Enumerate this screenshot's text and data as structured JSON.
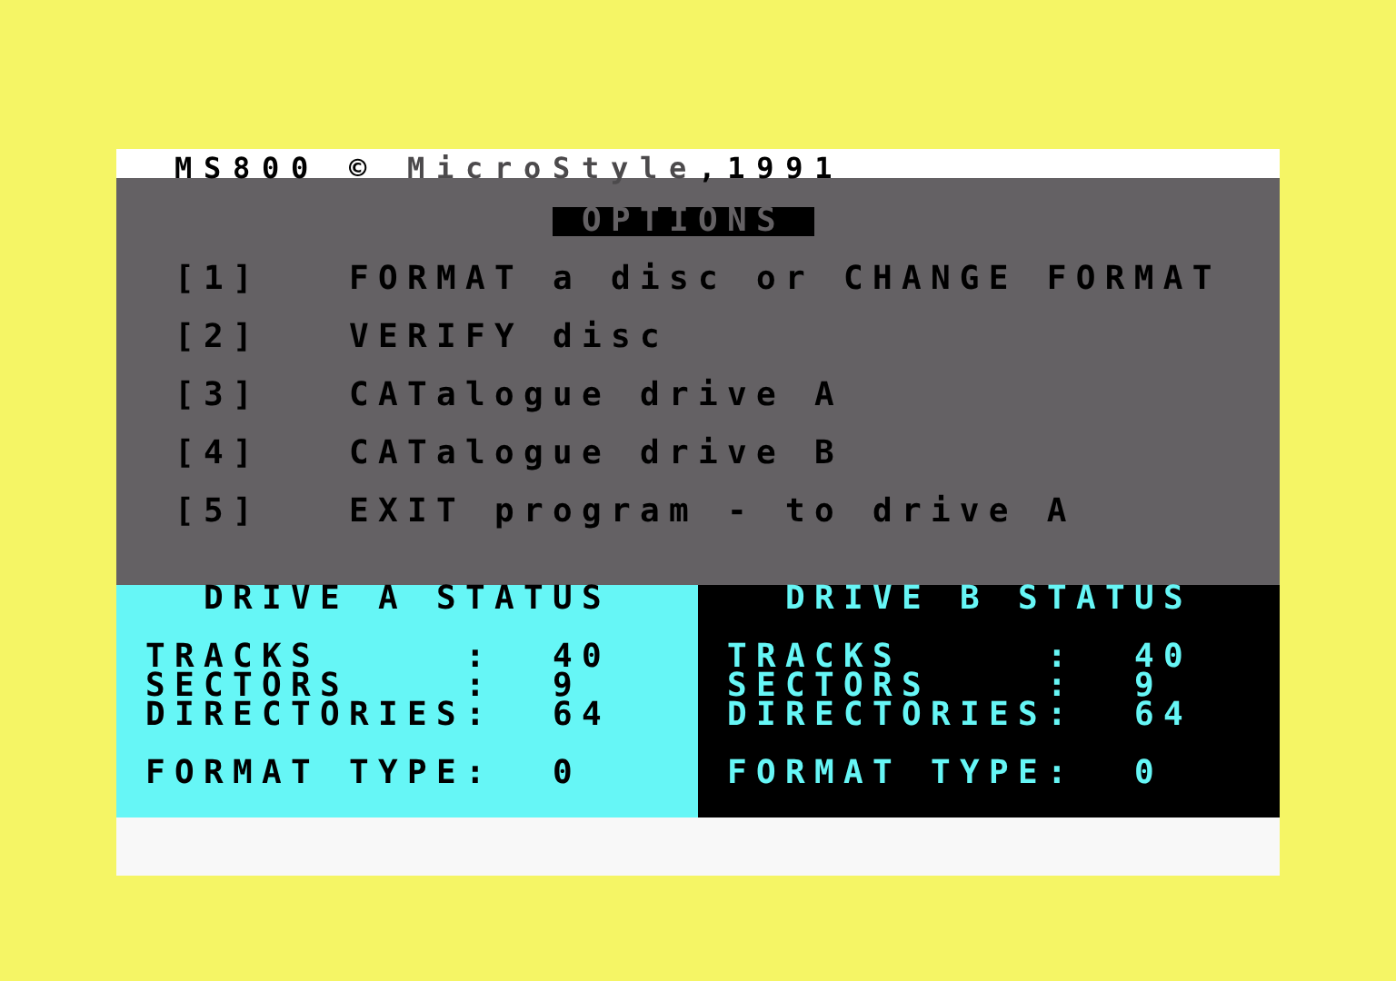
{
  "header": {
    "segments": [
      {
        "text": "MS800 © ",
        "color": "#000000"
      },
      {
        "text": "MicroStyle",
        "color": "#4c4a4c"
      },
      {
        "text": ",1991",
        "color": "#000000"
      }
    ]
  },
  "options": {
    "title": "OPTIONS",
    "items": [
      {
        "key": "[1]",
        "label": "FORMAT a disc or CHANGE FORMAT"
      },
      {
        "key": "[2]",
        "label": "VERIFY disc"
      },
      {
        "key": "[3]",
        "label": "CATalogue drive A"
      },
      {
        "key": "[4]",
        "label": "CATalogue drive B"
      },
      {
        "key": "[5]",
        "label": "EXIT program - to drive A"
      }
    ]
  },
  "drives": [
    {
      "title": "DRIVE A STATUS",
      "inverted": false,
      "stats": [
        {
          "label": "TRACKS",
          "separator": ":",
          "value": "40"
        },
        {
          "label": "SECTORS",
          "separator": ":",
          "value": "9"
        },
        {
          "label": "DIRECTORIES",
          "separator": ":",
          "value": "64"
        }
      ],
      "format": {
        "label": "FORMAT TYPE",
        "separator": ":",
        "value": "0"
      }
    },
    {
      "title": "DRIVE B STATUS",
      "inverted": true,
      "stats": [
        {
          "label": "TRACKS",
          "separator": ":",
          "value": "40"
        },
        {
          "label": "SECTORS",
          "separator": ":",
          "value": "9"
        },
        {
          "label": "DIRECTORIES",
          "separator": ":",
          "value": "64"
        }
      ],
      "format": {
        "label": "FORMAT TYPE",
        "separator": ":",
        "value": "0"
      }
    }
  ]
}
